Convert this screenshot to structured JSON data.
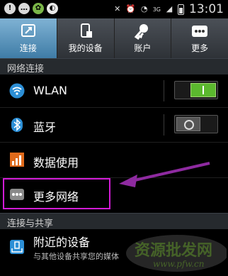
{
  "status_bar": {
    "time": "13:01",
    "network": "3G"
  },
  "tabs": [
    {
      "label": "连接",
      "icon": "connections-icon",
      "active": true
    },
    {
      "label": "我的设备",
      "icon": "my-device-icon",
      "active": false
    },
    {
      "label": "账户",
      "icon": "accounts-icon",
      "active": false
    },
    {
      "label": "更多",
      "icon": "more-icon",
      "active": false
    }
  ],
  "sections": {
    "network": "网络连接",
    "share": "连接与共享"
  },
  "items": {
    "wlan": {
      "label": "WLAN",
      "icon": "wifi-icon",
      "toggle": "on"
    },
    "bluetooth": {
      "label": "蓝牙",
      "icon": "bluetooth-icon",
      "toggle": "off"
    },
    "data_usage": {
      "label": "数据使用",
      "icon": "chart-icon"
    },
    "more_networks": {
      "label": "更多网络",
      "icon": "dots-icon"
    },
    "nearby": {
      "label": "附近的设备",
      "description": "与其他设备共享您的媒体",
      "icon": "share-icon"
    }
  },
  "watermark": {
    "text": "资源批发网",
    "url": "www.pfw.cn"
  },
  "colors": {
    "highlight": "#d21bd6",
    "toggle_on": "#5bb82e",
    "tab_active": "#5a96bf"
  }
}
